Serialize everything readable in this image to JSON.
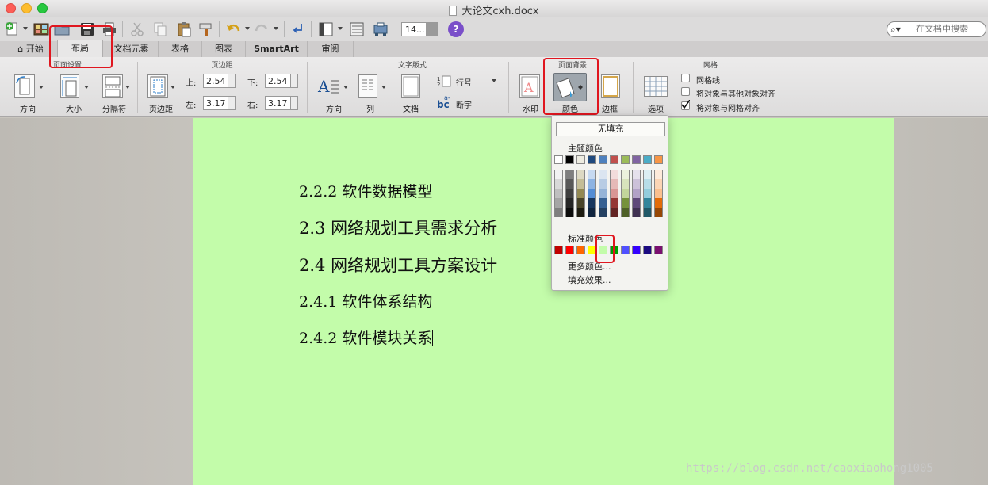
{
  "window": {
    "title": "大论文cxh.docx"
  },
  "toolbar": {
    "zoom_value": "14..."
  },
  "search": {
    "placeholder": "在文档中搜索"
  },
  "tabs": [
    {
      "label": "开始",
      "active": false
    },
    {
      "label": "布局",
      "active": true
    },
    {
      "label": "文档元素",
      "active": false
    },
    {
      "label": "表格",
      "active": false
    },
    {
      "label": "图表",
      "active": false
    },
    {
      "label": "SmartArt",
      "active": false
    },
    {
      "label": "审阅",
      "active": false
    }
  ],
  "ribbon": {
    "page_setup": {
      "title": "页面设置",
      "orientation_label": "方向",
      "size_label": "大小",
      "breaks_label": "分隔符"
    },
    "margins": {
      "title": "页边距",
      "margins_label": "页边距",
      "top_label": "上:",
      "top_value": "2.54",
      "bottom_label": "下:",
      "bottom_value": "2.54",
      "left_label": "左:",
      "left_value": "3.17",
      "right_label": "右:",
      "right_value": "3.17"
    },
    "text_layout": {
      "title": "文字版式",
      "direction_label": "方向",
      "columns_label": "列",
      "document_label": "文档",
      "line_numbers_label": "行号",
      "hyphenation_label": "断字"
    },
    "page_background": {
      "title": "页面背景",
      "watermark_label": "水印",
      "color_label": "颜色",
      "borders_label": "边框"
    },
    "grid": {
      "title": "网格",
      "options_label": "选项",
      "gridlines_label": "网格线",
      "gridlines_checked": false,
      "snap_objects_label": "将对象与其他对象对齐",
      "snap_objects_checked": false,
      "snap_grid_label": "将对象与网格对齐",
      "snap_grid_checked": true
    }
  },
  "document": {
    "background_color": "#c3fcaa",
    "headings": [
      {
        "text": "2.2.2 软件数据模型",
        "level": 3
      },
      {
        "text": "2.3 网络规划工具需求分析",
        "level": 2
      },
      {
        "text": "2.4 网络规划工具方案设计",
        "level": 2
      },
      {
        "text": "2.4.1 软件体系结构",
        "level": 3
      },
      {
        "text": "2.4.2 软件模块关系",
        "level": 3
      }
    ]
  },
  "color_menu": {
    "no_fill_label": "无填充",
    "theme_colors_label": "主题颜色",
    "theme_colors": [
      "#ffffff",
      "#000000",
      "#eeece1",
      "#1f497d",
      "#4f81bd",
      "#c0504d",
      "#9bbb59",
      "#8064a2",
      "#4bacc6",
      "#f79646"
    ],
    "theme_shades": [
      [
        "#f2f2f2",
        "#d8d8d8",
        "#bfbfbf",
        "#a5a5a5",
        "#7f7f7f"
      ],
      [
        "#7f7f7f",
        "#595959",
        "#3f3f3f",
        "#262626",
        "#0c0c0c"
      ],
      [
        "#ddd9c3",
        "#c4bd97",
        "#938953",
        "#494429",
        "#1d1b10"
      ],
      [
        "#c6d9f0",
        "#8db3e2",
        "#548dd4",
        "#17365d",
        "#0f243e"
      ],
      [
        "#dbe5f1",
        "#b8cce4",
        "#95b3d7",
        "#366092",
        "#244061"
      ],
      [
        "#f2dcdb",
        "#e5b9b7",
        "#d99694",
        "#953734",
        "#632423"
      ],
      [
        "#ebf1dd",
        "#d7e3bc",
        "#c3d69b",
        "#76923c",
        "#4f6128"
      ],
      [
        "#e5e0ec",
        "#ccc1d9",
        "#b2a2c7",
        "#5f497a",
        "#3f3151"
      ],
      [
        "#dbeef3",
        "#b7dde8",
        "#92cddc",
        "#31859b",
        "#205867"
      ],
      [
        "#fdeada",
        "#fbd5b5",
        "#fac08f",
        "#e36c09",
        "#974806"
      ]
    ],
    "standard_colors_label": "标准颜色",
    "standard_colors": [
      "#c00000",
      "#ff0000",
      "#ff6600",
      "#ffff00",
      "#c3fcaa",
      "#00a000",
      "#5050ff",
      "#3300ff",
      "#1a0a80",
      "#7a1070"
    ],
    "selected_standard_color": "#c3fcaa",
    "more_colors_label": "更多颜色...",
    "fill_effects_label": "填充效果..."
  },
  "watermark_text": "https://blog.csdn.net/caoxiaohong1005"
}
